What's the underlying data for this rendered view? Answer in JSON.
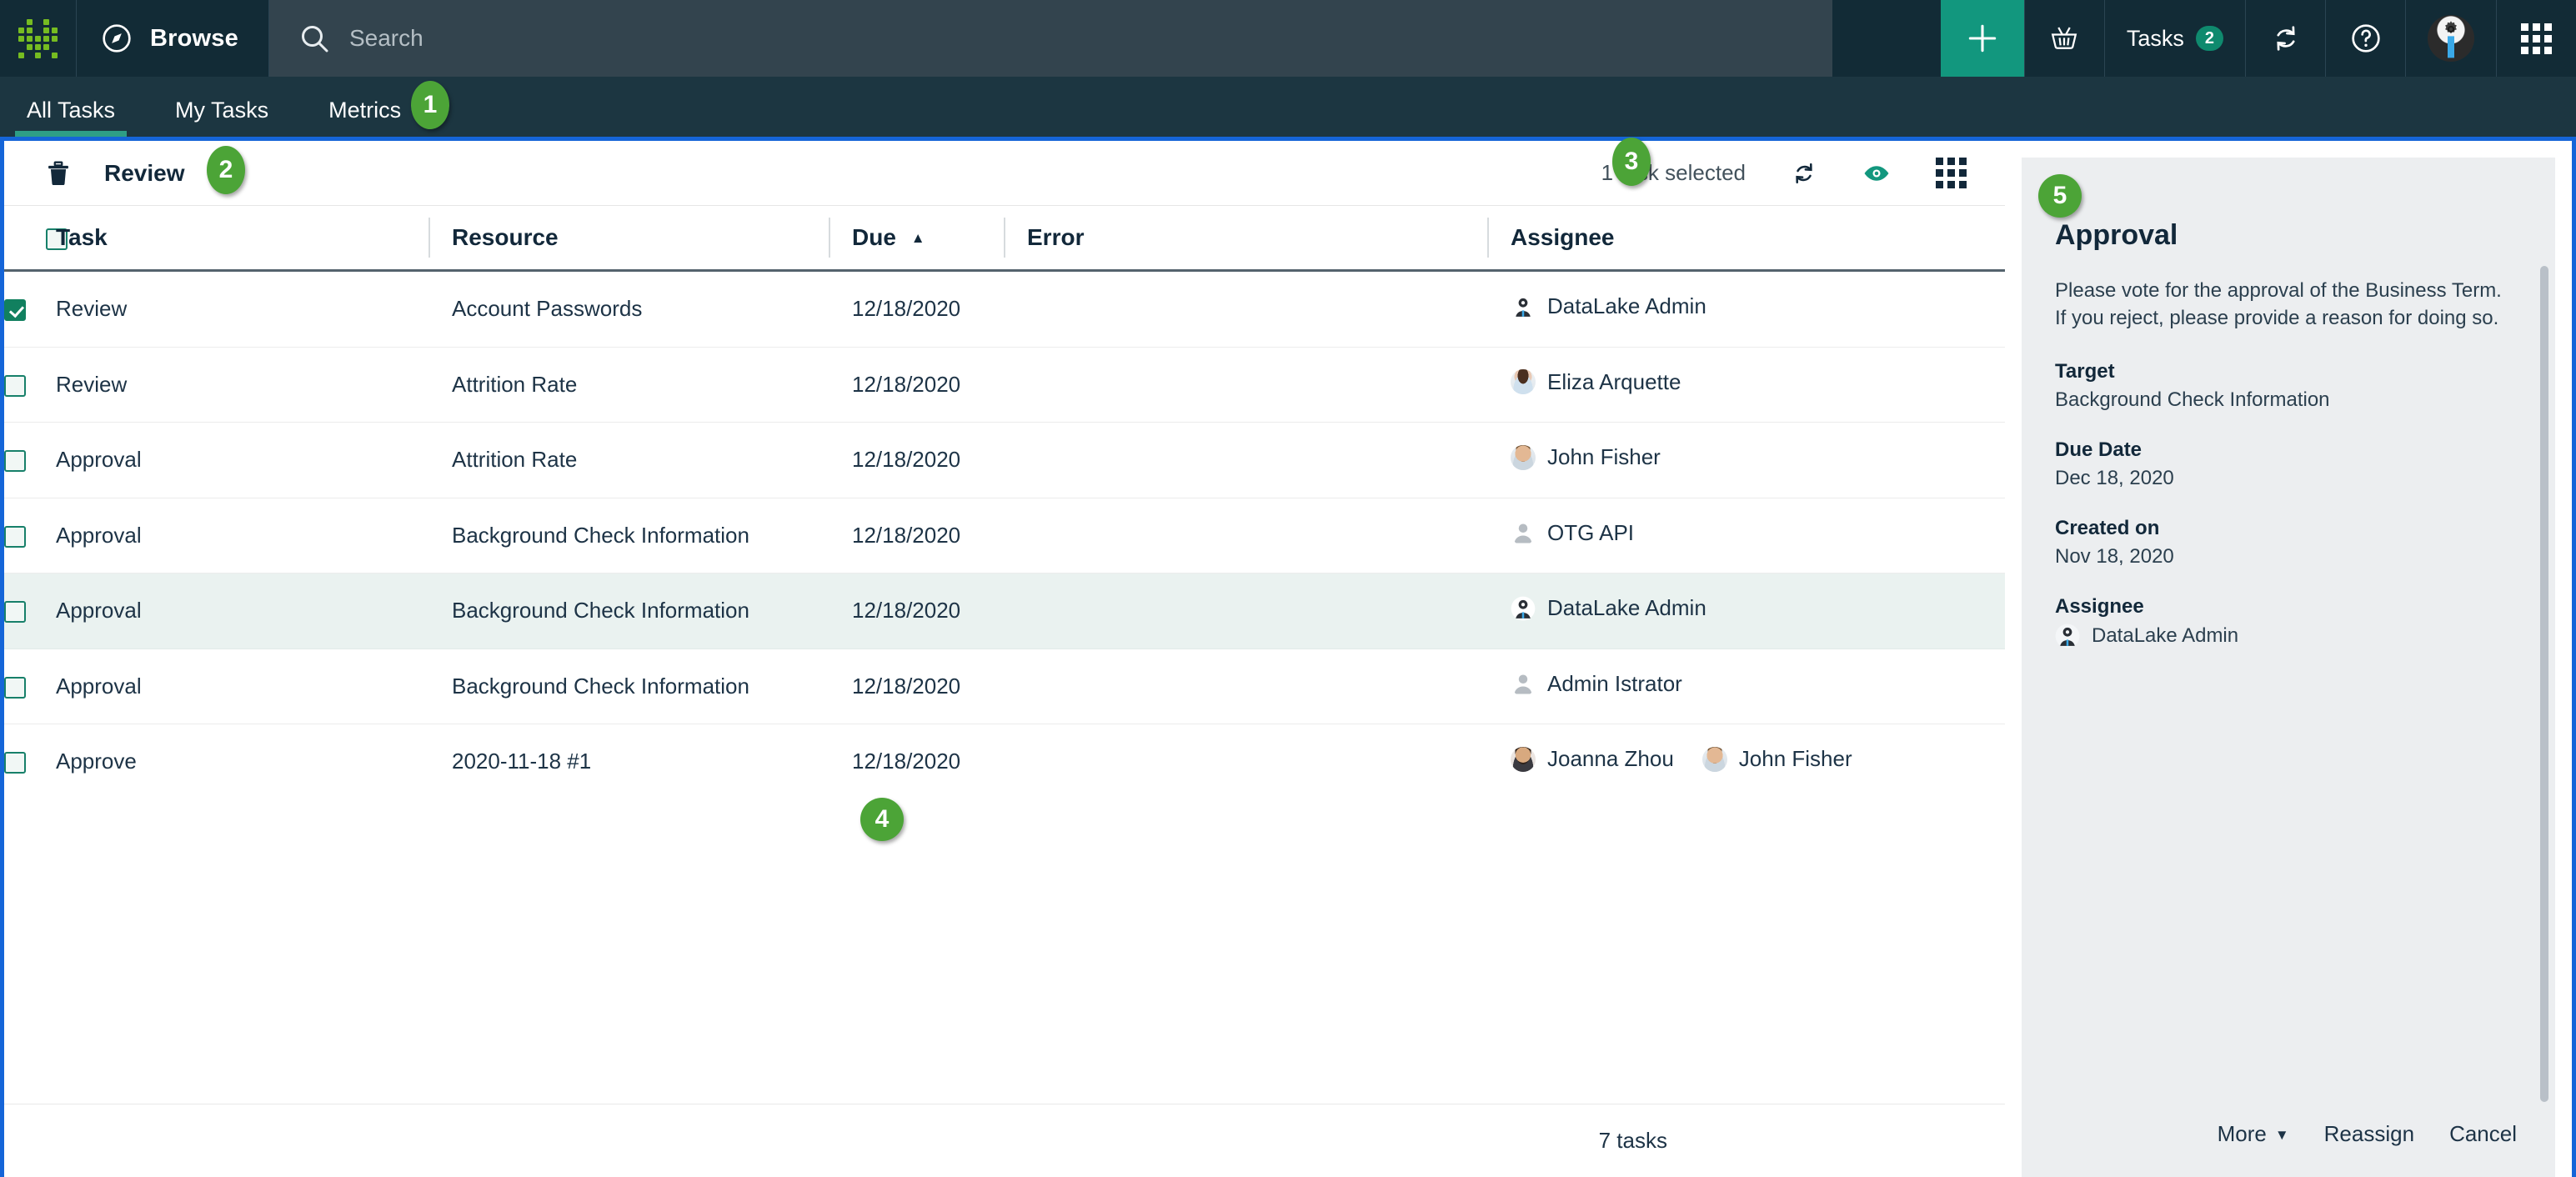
{
  "header": {
    "logo_name": "collibra-logo",
    "browse_label": "Browse",
    "search_placeholder": "Search",
    "search_value": "",
    "plus_label": "+",
    "basket_icon": "basket-icon",
    "tasks_label": "Tasks",
    "tasks_count": "2",
    "sync_icon": "sync-icon",
    "help_icon": "help-icon",
    "avatar_icon": "user-avatar-icon",
    "apps_icon": "apps-grid-icon"
  },
  "tabs": [
    {
      "label": "All Tasks",
      "active": true
    },
    {
      "label": "My Tasks",
      "active": false
    },
    {
      "label": "Metrics",
      "active": false
    }
  ],
  "steps": {
    "one": "1",
    "two": "2",
    "three": "3",
    "four": "4",
    "five": "5"
  },
  "toolbar": {
    "delete_icon": "trash-icon",
    "title": "Review",
    "selection_text": "1 task selected",
    "refresh_icon": "refresh-icon",
    "preview_icon": "eye-icon",
    "grid_icon": "grid-view-icon"
  },
  "table": {
    "columns": [
      "Task",
      "Resource",
      "Due",
      "Error",
      "Assignee"
    ],
    "sort_column": "Due",
    "sort_direction": "ascending",
    "sort_arrow": "▲",
    "rows": [
      {
        "checked": true,
        "selected": false,
        "task": "Review",
        "resource": "Account Passwords",
        "due": "12/18/2020",
        "error": "",
        "assignees": [
          {
            "name": "DataLake Admin",
            "avatar": "robot"
          }
        ]
      },
      {
        "checked": false,
        "selected": false,
        "task": "Review",
        "resource": "Attrition Rate",
        "due": "12/18/2020",
        "error": "",
        "assignees": [
          {
            "name": "Eliza Arquette",
            "avatar": "photo-f"
          }
        ]
      },
      {
        "checked": false,
        "selected": false,
        "task": "Approval",
        "resource": "Attrition Rate",
        "due": "12/18/2020",
        "error": "",
        "assignees": [
          {
            "name": "John Fisher",
            "avatar": "photo-m"
          }
        ]
      },
      {
        "checked": false,
        "selected": false,
        "task": "Approval",
        "resource": "Background Check Information",
        "due": "12/18/2020",
        "error": "",
        "assignees": [
          {
            "name": "OTG API",
            "avatar": "generic"
          }
        ]
      },
      {
        "checked": false,
        "selected": true,
        "task": "Approval",
        "resource": "Background Check Information",
        "due": "12/18/2020",
        "error": "",
        "assignees": [
          {
            "name": "DataLake Admin",
            "avatar": "robot"
          }
        ]
      },
      {
        "checked": false,
        "selected": false,
        "task": "Approval",
        "resource": "Background Check Information",
        "due": "12/18/2020",
        "error": "",
        "assignees": [
          {
            "name": "Admin Istrator",
            "avatar": "generic"
          }
        ]
      },
      {
        "checked": false,
        "selected": false,
        "task": "Approve",
        "resource": "2020-11-18 #1",
        "due": "12/18/2020",
        "error": "",
        "assignees": [
          {
            "name": "Joanna Zhou",
            "avatar": "photo-a"
          },
          {
            "name": "John Fisher",
            "avatar": "photo-m"
          }
        ]
      }
    ],
    "footer_count": "7 tasks"
  },
  "panel": {
    "title": "Approval",
    "description": "Please vote for the approval of the Business Term. If you reject, please provide a reason for doing so.",
    "fields": [
      {
        "label": "Target",
        "value": "Background Check Information"
      },
      {
        "label": "Due Date",
        "value": "Dec 18, 2020"
      },
      {
        "label": "Created on",
        "value": "Nov 18, 2020"
      }
    ],
    "assignee_label": "Assignee",
    "assignee_name": "DataLake Admin",
    "actions": {
      "more": "More",
      "more_caret": "▼",
      "reassign": "Reassign",
      "cancel": "Cancel"
    }
  },
  "colors": {
    "header_bg": "#122b36",
    "tabbar_bg": "#1c3641",
    "accent_teal": "#12977e",
    "step_green": "#4ca437",
    "focus_blue": "#1565d8",
    "panel_bg": "#eceef0",
    "selected_row": "#eaf2f0"
  }
}
